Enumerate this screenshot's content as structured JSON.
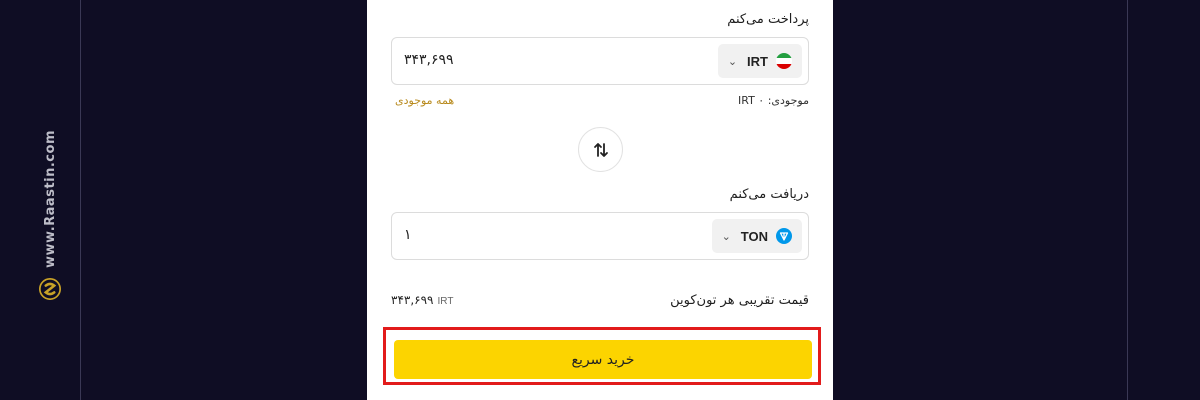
{
  "watermark": {
    "text": "www.Raastin.com",
    "logo": "raastin-logo"
  },
  "pay": {
    "label": "پرداخت می‌کنم",
    "amount": "۳۴۳,۶۹۹",
    "currency_code": "IRT",
    "currency_icon": "iran-flag-icon",
    "balance_text": "موجودی: IRT ۰",
    "all_balance_link": "همه موجودی"
  },
  "swap": {
    "icon": "swap-arrows-icon"
  },
  "receive": {
    "label": "دریافت می‌کنم",
    "amount": "۱",
    "currency_code": "TON",
    "currency_icon": "ton-icon"
  },
  "price": {
    "label": "قیمت تقریبی هر تون‌کوین",
    "value": "۳۴۳,۶۹۹",
    "unit": "IRT"
  },
  "buy_button": {
    "label": "خرید سریع",
    "color": "#fcd400"
  },
  "highlight_color": "#e21b1b",
  "iran_flag": {
    "top": "#239f40",
    "middle": "#ffffff",
    "bottom": "#da0000"
  }
}
